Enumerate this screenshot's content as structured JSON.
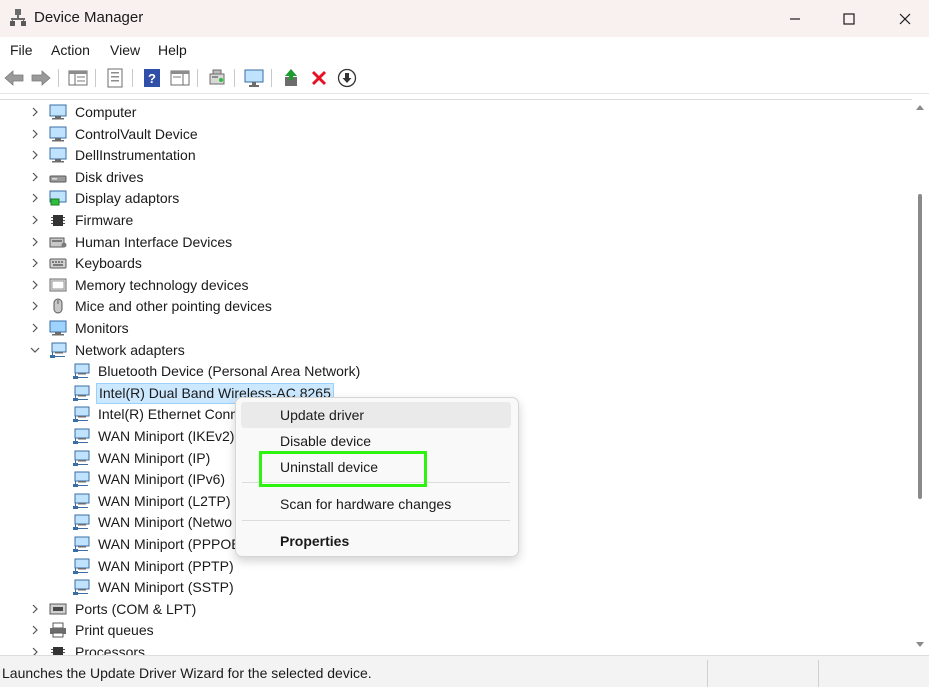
{
  "window": {
    "title": "Device Manager"
  },
  "menu": [
    "File",
    "Action",
    "View",
    "Help"
  ],
  "toolbar": {
    "icons": [
      "back-arrow-icon",
      "forward-arrow-icon",
      "show-hide-tree-icon",
      "properties-icon",
      "help-icon",
      "action-pane-icon",
      "scan-hardware-icon",
      "monitor-icon",
      "update-driver-icon",
      "uninstall-x-icon",
      "download-icon"
    ]
  },
  "tree": [
    {
      "label": "Computer",
      "level": 0,
      "expander": "collapsed",
      "icon": "computer-icon"
    },
    {
      "label": "ControlVault Device",
      "level": 0,
      "expander": "collapsed",
      "icon": "device-monitor-icon"
    },
    {
      "label": "DellInstrumentation",
      "level": 0,
      "expander": "collapsed",
      "icon": "device-monitor-icon"
    },
    {
      "label": "Disk drives",
      "level": 0,
      "expander": "collapsed",
      "icon": "disk-drive-icon"
    },
    {
      "label": "Display adaptors",
      "level": 0,
      "expander": "collapsed",
      "icon": "display-adapter-icon"
    },
    {
      "label": "Firmware",
      "level": 0,
      "expander": "collapsed",
      "icon": "chip-icon"
    },
    {
      "label": "Human Interface Devices",
      "level": 0,
      "expander": "collapsed",
      "icon": "hid-icon"
    },
    {
      "label": "Keyboards",
      "level": 0,
      "expander": "collapsed",
      "icon": "keyboard-icon"
    },
    {
      "label": "Memory technology devices",
      "level": 0,
      "expander": "collapsed",
      "icon": "memory-icon"
    },
    {
      "label": "Mice and other pointing devices",
      "level": 0,
      "expander": "collapsed",
      "icon": "mouse-icon"
    },
    {
      "label": "Monitors",
      "level": 0,
      "expander": "collapsed",
      "icon": "monitor-icon"
    },
    {
      "label": "Network adapters",
      "level": 0,
      "expander": "expanded",
      "icon": "network-icon"
    },
    {
      "label": "Bluetooth Device (Personal Area Network)",
      "level": 1,
      "expander": "none",
      "icon": "network-icon"
    },
    {
      "label": "Intel(R) Dual Band Wireless-AC 8265",
      "level": 1,
      "expander": "none",
      "icon": "network-icon",
      "selected": true
    },
    {
      "label": "Intel(R) Ethernet Conn",
      "level": 1,
      "expander": "none",
      "icon": "network-icon"
    },
    {
      "label": "WAN Miniport (IKEv2)",
      "level": 1,
      "expander": "none",
      "icon": "network-icon"
    },
    {
      "label": "WAN Miniport (IP)",
      "level": 1,
      "expander": "none",
      "icon": "network-icon"
    },
    {
      "label": "WAN Miniport (IPv6)",
      "level": 1,
      "expander": "none",
      "icon": "network-icon"
    },
    {
      "label": "WAN Miniport (L2TP)",
      "level": 1,
      "expander": "none",
      "icon": "network-icon"
    },
    {
      "label": "WAN Miniport (Netwo",
      "level": 1,
      "expander": "none",
      "icon": "network-icon"
    },
    {
      "label": "WAN Miniport (PPPOE",
      "level": 1,
      "expander": "none",
      "icon": "network-icon"
    },
    {
      "label": "WAN Miniport (PPTP)",
      "level": 1,
      "expander": "none",
      "icon": "network-icon"
    },
    {
      "label": "WAN Miniport (SSTP)",
      "level": 1,
      "expander": "none",
      "icon": "network-icon"
    },
    {
      "label": "Ports (COM & LPT)",
      "level": 0,
      "expander": "collapsed",
      "icon": "port-icon"
    },
    {
      "label": "Print queues",
      "level": 0,
      "expander": "collapsed",
      "icon": "printer-icon"
    },
    {
      "label": "Processors",
      "level": 0,
      "expander": "collapsed",
      "icon": "chip-icon"
    }
  ],
  "context_menu": {
    "items": [
      {
        "label": "Update driver",
        "bold": false,
        "hovered": true
      },
      {
        "label": "Disable device",
        "bold": false
      },
      {
        "label": "Uninstall device",
        "bold": false,
        "highlighted": true
      },
      {
        "label": "Scan for hardware changes",
        "bold": false
      },
      {
        "label": "Properties",
        "bold": true
      }
    ]
  },
  "status": {
    "text": "Launches the Update Driver Wizard for the selected device."
  },
  "colors": {
    "selection_bg": "#cce8ff",
    "selection_border": "#99d1ff",
    "highlight_box": "#2ef20f",
    "titlebar_bg": "#f9f1ef",
    "delete_red": "#e81123"
  }
}
